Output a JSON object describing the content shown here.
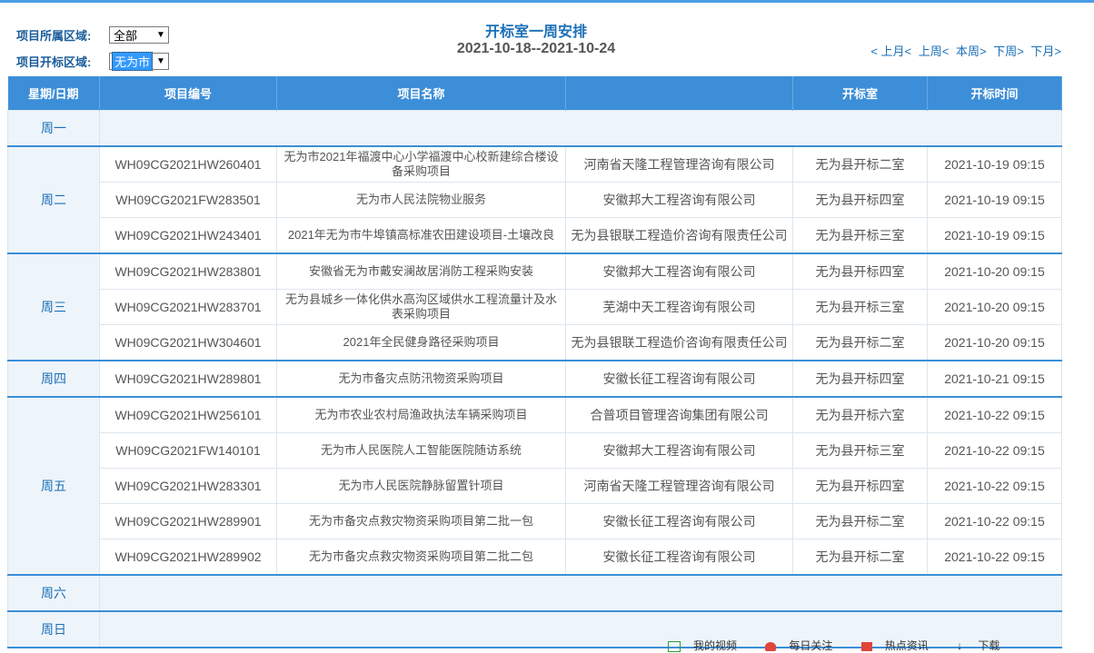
{
  "filters": {
    "region_label": "项目所属区域:",
    "region_value": "全部",
    "bid_region_label": "项目开标区域:",
    "bid_region_value": "无为市"
  },
  "header": {
    "title": "开标室一周安排",
    "date_range": "2021-10-18--2021-10-24"
  },
  "nav": {
    "prev_month": "< 上月<",
    "prev_week": "上周<",
    "this_week": "本周>",
    "next_week": "下周>",
    "next_month": "下月>"
  },
  "table": {
    "columns": [
      "星期/日期",
      "项目编号",
      "项目名称",
      "开标室",
      "开标时间"
    ],
    "days": [
      {
        "day": "周一",
        "rows": []
      },
      {
        "day": "周二",
        "rows": [
          {
            "code": "WH09CG2021HW260401",
            "name": "无为市2021年福渡中心小学福渡中心校新建综合楼设备采购项目",
            "agency": "河南省天隆工程管理咨询有限公司",
            "room": "无为县开标二室",
            "time": "2021-10-19 09:15"
          },
          {
            "code": "WH09CG2021FW283501",
            "name": "无为市人民法院物业服务",
            "agency": "安徽邦大工程咨询有限公司",
            "room": "无为县开标四室",
            "time": "2021-10-19 09:15"
          },
          {
            "code": "WH09CG2021HW243401",
            "name": "2021年无为市牛埠镇高标准农田建设项目-土壤改良",
            "agency": "无为县银联工程造价咨询有限责任公司",
            "room": "无为县开标三室",
            "time": "2021-10-19 09:15"
          }
        ]
      },
      {
        "day": "周三",
        "rows": [
          {
            "code": "WH09CG2021HW283801",
            "name": "安徽省无为市戴安澜故居消防工程采购安装",
            "agency": "安徽邦大工程咨询有限公司",
            "room": "无为县开标四室",
            "time": "2021-10-20 09:15"
          },
          {
            "code": "WH09CG2021HW283701",
            "name": "无为县城乡一体化供水高沟区域供水工程流量计及水表采购项目",
            "agency": "芜湖中天工程咨询有限公司",
            "room": "无为县开标三室",
            "time": "2021-10-20 09:15"
          },
          {
            "code": "WH09CG2021HW304601",
            "name": "2021年全民健身路径采购项目",
            "agency": "无为县银联工程造价咨询有限责任公司",
            "room": "无为县开标二室",
            "time": "2021-10-20 09:15"
          }
        ]
      },
      {
        "day": "周四",
        "rows": [
          {
            "code": "WH09CG2021HW289801",
            "name": "无为市备灾点防汛物资采购项目",
            "agency": "安徽长征工程咨询有限公司",
            "room": "无为县开标四室",
            "time": "2021-10-21 09:15"
          }
        ]
      },
      {
        "day": "周五",
        "rows": [
          {
            "code": "WH09CG2021HW256101",
            "name": "无为市农业农村局渔政执法车辆采购项目",
            "agency": "合普项目管理咨询集团有限公司",
            "room": "无为县开标六室",
            "time": "2021-10-22 09:15"
          },
          {
            "code": "WH09CG2021FW140101",
            "name": "无为市人民医院人工智能医院随访系统",
            "agency": "安徽邦大工程咨询有限公司",
            "room": "无为县开标三室",
            "time": "2021-10-22 09:15"
          },
          {
            "code": "WH09CG2021HW283301",
            "name": "无为市人民医院静脉留置针项目",
            "agency": "河南省天隆工程管理咨询有限公司",
            "room": "无为县开标四室",
            "time": "2021-10-22 09:15"
          },
          {
            "code": "WH09CG2021HW289901",
            "name": "无为市备灾点救灾物资采购项目第二批一包",
            "agency": "安徽长征工程咨询有限公司",
            "room": "无为县开标二室",
            "time": "2021-10-22 09:15"
          },
          {
            "code": "WH09CG2021HW289902",
            "name": "无为市备灾点救灾物资采购项目第二批二包",
            "agency": "安徽长征工程咨询有限公司",
            "room": "无为县开标二室",
            "time": "2021-10-22 09:15"
          }
        ]
      },
      {
        "day": "周六",
        "rows": []
      },
      {
        "day": "周日",
        "rows": []
      }
    ]
  },
  "statusbar": {
    "items": [
      "我的视频",
      "每日关注",
      "热点资讯",
      "下载"
    ]
  }
}
